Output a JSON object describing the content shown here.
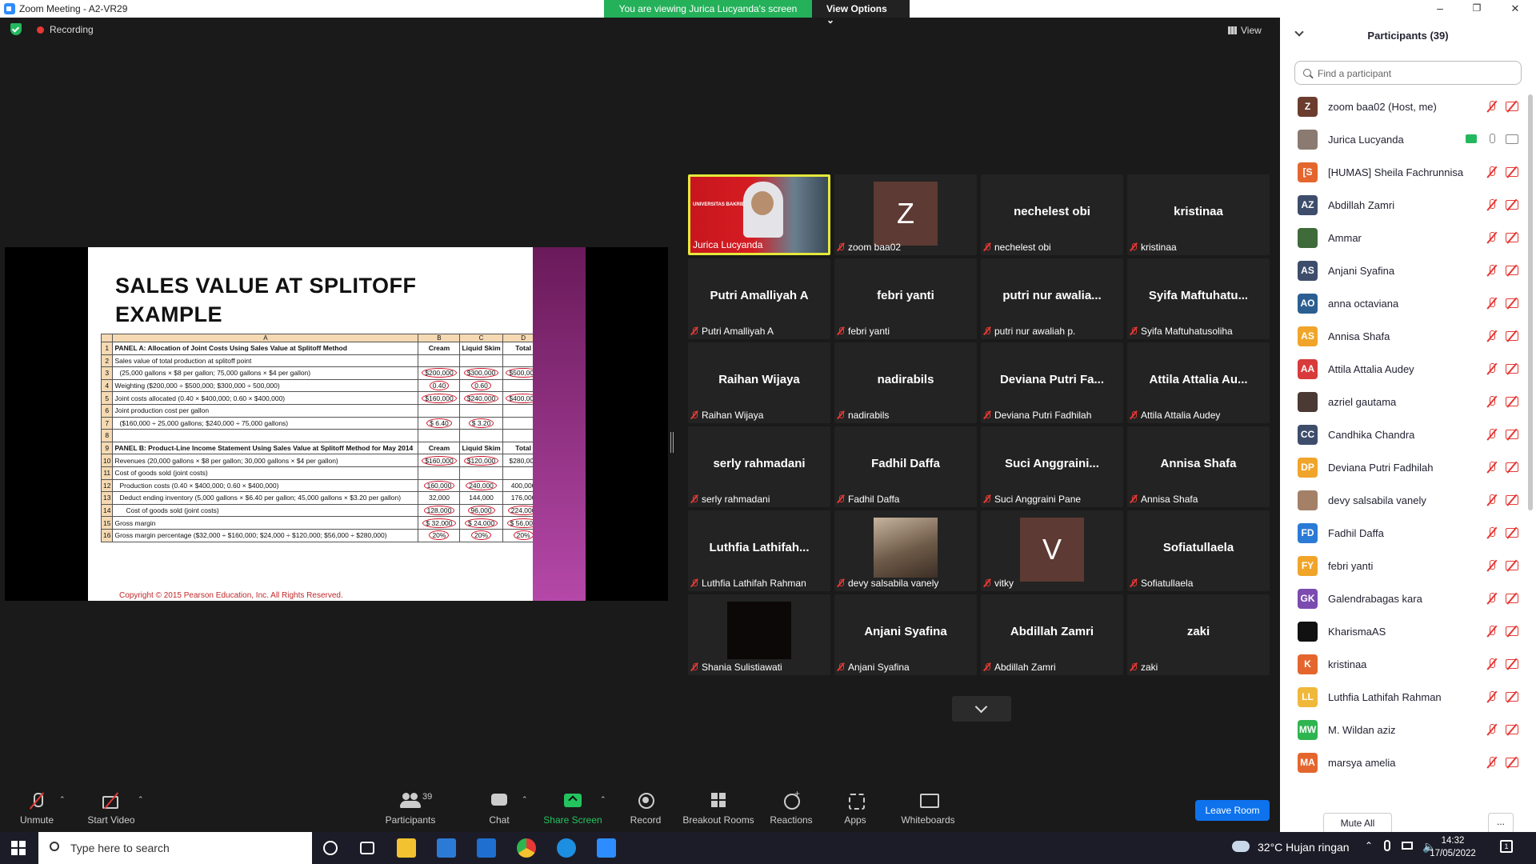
{
  "window": {
    "title": "Zoom Meeting - A2-VR29",
    "min": "–",
    "max": "❐",
    "close": "✕"
  },
  "banner": {
    "text": "You are viewing Jurica Lucyanda's screen",
    "view_options": "View Options ⌄"
  },
  "status": {
    "recording": "Recording",
    "view": "View"
  },
  "slide": {
    "title_line1": "SALES VALUE AT SPLITOFF",
    "title_line2": "EXAMPLE",
    "col_headers": [
      "",
      "A",
      "B",
      "C",
      "D"
    ],
    "rows": [
      {
        "n": "1",
        "label": "PANEL A: Allocation of Joint Costs Using Sales Value at Splitoff Method",
        "b": "Cream",
        "c": "Liquid Skim",
        "d": "Total",
        "bold": true
      },
      {
        "n": "2",
        "label": "Sales value of total production at splitoff point",
        "b": "",
        "c": "",
        "d": ""
      },
      {
        "n": "3",
        "label": "(25,000 gallons × $8 per gallon; 75,000 gallons × $4 per gallon)",
        "b": "$200,000",
        "c": "$300,000",
        "d": "$500,000"
      },
      {
        "n": "4",
        "label": "Weighting ($200,000 ÷ $500,000; $300,000 ÷ 500,000)",
        "b": "0.40",
        "c": "0.60",
        "d": ""
      },
      {
        "n": "5",
        "label": "Joint costs allocated (0.40 × $400,000; 0.60 × $400,000)",
        "b": "$160,000",
        "c": "$240,000",
        "d": "$400,000"
      },
      {
        "n": "6",
        "label": "Joint production cost per gallon",
        "b": "",
        "c": "",
        "d": ""
      },
      {
        "n": "7",
        "label": "($160,000 ÷ 25,000 gallons; $240,000 ÷ 75,000 gallons)",
        "b": "$ 6.40",
        "c": "$ 3.20",
        "d": ""
      },
      {
        "n": "8",
        "label": "",
        "b": "",
        "c": "",
        "d": ""
      },
      {
        "n": "9",
        "label": "PANEL B: Product-Line Income Statement Using Sales Value at Splitoff Method for May 2014",
        "b": "Cream",
        "c": "Liquid Skim",
        "d": "Total",
        "bold": true
      },
      {
        "n": "10",
        "label": "Revenues (20,000 gallons × $8 per gallon; 30,000 gallons × $4 per gallon)",
        "b": "$160,000",
        "c": "$120,000",
        "d": "$280,000"
      },
      {
        "n": "11",
        "label": "Cost of goods sold (joint costs)",
        "b": "",
        "c": "",
        "d": ""
      },
      {
        "n": "12",
        "label": "Production costs (0.40 × $400,000; 0.60 × $400,000)",
        "b": "160,000",
        "c": "240,000",
        "d": "400,000"
      },
      {
        "n": "13",
        "label": "Deduct ending inventory (5,000 gallons × $6.40 per gallon; 45,000 gallons × $3.20 per gallon)",
        "b": "32,000",
        "c": "144,000",
        "d": "176,000"
      },
      {
        "n": "14",
        "label": "Cost of goods sold (joint costs)",
        "b": "128,000",
        "c": "96,000",
        "d": "224,000"
      },
      {
        "n": "15",
        "label": "Gross margin",
        "b": "$ 32,000",
        "c": "$ 24,000",
        "d": "$ 56,000"
      },
      {
        "n": "16",
        "label": "Gross margin percentage ($32,000 ÷ $160,000; $24,000 ÷ $120,000; $56,000 ÷ $280,000)",
        "b": "20%",
        "c": "20%",
        "d": "20%"
      }
    ],
    "copyright": "Copyright © 2015 Pearson Education, Inc. All Rights Reserved."
  },
  "video_logo": "UNIVERSITAS BAKRIE",
  "gallery": [
    {
      "name": "Jurica Lucyanda",
      "big": "",
      "kind": "video"
    },
    {
      "name": "zoom baa02",
      "big": "Z",
      "kind": "letter"
    },
    {
      "name": "nechelest obi",
      "big": "nechelest obi",
      "kind": "text"
    },
    {
      "name": "kristinaa",
      "big": "kristinaa",
      "kind": "text"
    },
    {
      "name": "Putri Amalliyah A",
      "big": "Putri Amalliyah A",
      "kind": "text"
    },
    {
      "name": "febri yanti",
      "big": "febri yanti",
      "kind": "text"
    },
    {
      "name": "putri nur awaliah p.",
      "big": "putri nur awalia...",
      "kind": "text"
    },
    {
      "name": "Syifa Maftuhatusoliha",
      "big": "Syifa Maftuhatu...",
      "kind": "text"
    },
    {
      "name": "Raihan Wijaya",
      "big": "Raihan Wijaya",
      "kind": "text"
    },
    {
      "name": "nadirabils",
      "big": "nadirabils",
      "kind": "text"
    },
    {
      "name": "Deviana Putri Fadhilah",
      "big": "Deviana Putri Fa...",
      "kind": "text"
    },
    {
      "name": "Attila Attalia Audey",
      "big": "Attila Attalia Au...",
      "kind": "text"
    },
    {
      "name": "serly rahmadani",
      "big": "serly rahmadani",
      "kind": "text"
    },
    {
      "name": "Fadhil Daffa",
      "big": "Fadhil Daffa",
      "kind": "text"
    },
    {
      "name": "Suci Anggraini Pane",
      "big": "Suci Anggraini...",
      "kind": "text"
    },
    {
      "name": "Annisa Shafa",
      "big": "Annisa Shafa",
      "kind": "text"
    },
    {
      "name": "Luthfia Lathifah Rahman",
      "big": "Luthfia Lathifah...",
      "kind": "text"
    },
    {
      "name": "devy salsabila vanely",
      "big": "",
      "kind": "photo"
    },
    {
      "name": "vitky",
      "big": "V",
      "kind": "letter"
    },
    {
      "name": "Sofiatullaela",
      "big": "Sofiatullaela",
      "kind": "text"
    },
    {
      "name": "Shania Sulistiawati",
      "big": "",
      "kind": "dark"
    },
    {
      "name": "Anjani Syafina",
      "big": "Anjani Syafina",
      "kind": "text"
    },
    {
      "name": "Abdillah Zamri",
      "big": "Abdillah Zamri",
      "kind": "text"
    },
    {
      "name": "zaki",
      "big": "zaki",
      "kind": "text"
    }
  ],
  "toolbar": {
    "unmute": "Unmute",
    "start_video": "Start Video",
    "participants": "Participants",
    "participants_count": "39",
    "chat": "Chat",
    "share_screen": "Share Screen",
    "record": "Record",
    "breakout": "Breakout Rooms",
    "reactions": "Reactions",
    "apps": "Apps",
    "whiteboards": "Whiteboards",
    "leave": "Leave Room"
  },
  "panel": {
    "title": "Participants (39)",
    "search_placeholder": "Find a participant",
    "mute_all": "Mute All",
    "more": "...",
    "participants": [
      {
        "initials": "Z",
        "name": "zoom baa02 (Host, me)",
        "color": "#6b3d2e"
      },
      {
        "initials": "",
        "name": "Jurica Lucyanda",
        "color": "#8a7a70"
      },
      {
        "initials": "[S",
        "name": "[HUMAS] Sheila Fachrunnisa",
        "color": "#e4662e"
      },
      {
        "initials": "AZ",
        "name": "Abdillah Zamri",
        "color": "#3d4d6b"
      },
      {
        "initials": "",
        "name": "Ammar",
        "color": "#3f6b3a"
      },
      {
        "initials": "AS",
        "name": "Anjani Syafina",
        "color": "#3d4d6b"
      },
      {
        "initials": "AO",
        "name": "anna octaviana",
        "color": "#2b5f91"
      },
      {
        "initials": "AS",
        "name": "Annisa Shafa",
        "color": "#f0a52a"
      },
      {
        "initials": "AA",
        "name": "Attila Attalia Audey",
        "color": "#d83b3b"
      },
      {
        "initials": "",
        "name": "azriel gautama",
        "color": "#4a3a33"
      },
      {
        "initials": "CC",
        "name": "Candhika Chandra",
        "color": "#3d4d6b"
      },
      {
        "initials": "DP",
        "name": "Deviana Putri Fadhilah",
        "color": "#f0a52a"
      },
      {
        "initials": "",
        "name": "devy salsabila vanely",
        "color": "#a48066"
      },
      {
        "initials": "FD",
        "name": "Fadhil Daffa",
        "color": "#2b7bd6"
      },
      {
        "initials": "FY",
        "name": "febri yanti",
        "color": "#f0a52a"
      },
      {
        "initials": "GK",
        "name": "Galendrabagas kara",
        "color": "#7b4bb0"
      },
      {
        "initials": "",
        "name": "KharismaAS",
        "color": "#111"
      },
      {
        "initials": "K",
        "name": "kristinaa",
        "color": "#e4662e"
      },
      {
        "initials": "LL",
        "name": "Luthfia Lathifah Rahman",
        "color": "#f0b83a"
      },
      {
        "initials": "MW",
        "name": "M. Wildan aziz",
        "color": "#2fb550"
      },
      {
        "initials": "MA",
        "name": "marsya amelia",
        "color": "#e4662e"
      }
    ]
  },
  "taskbar": {
    "search": "Type here to search",
    "weather": "32°C  Hujan ringan",
    "time": "14:32",
    "date": "17/05/2022",
    "notif_count": "1"
  }
}
